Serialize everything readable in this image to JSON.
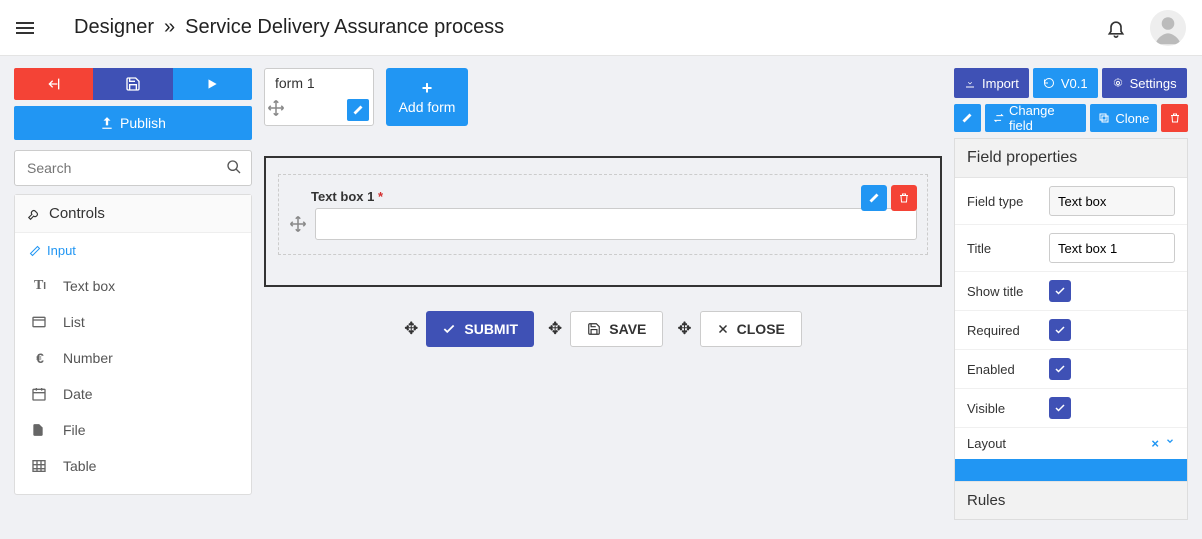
{
  "header": {
    "crumb1": "Designer",
    "sep": "»",
    "crumb2": "Service Delivery Assurance process"
  },
  "left": {
    "publish": "Publish",
    "search_placeholder": "Search",
    "controls_title": "Controls",
    "input_section": "Input",
    "items": [
      {
        "icon": "text-icon",
        "label": "Text box"
      },
      {
        "icon": "list-icon",
        "label": "List"
      },
      {
        "icon": "euro-icon",
        "label": "Number"
      },
      {
        "icon": "calendar-icon",
        "label": "Date"
      },
      {
        "icon": "file-icon",
        "label": "File"
      },
      {
        "icon": "table-icon",
        "label": "Table"
      }
    ]
  },
  "forms": {
    "chip_label": "form 1",
    "add_label": "Add form"
  },
  "field": {
    "label": "Text box 1",
    "asterisk": "*"
  },
  "buttons": {
    "submit": "SUBMIT",
    "save": "SAVE",
    "close": "CLOSE"
  },
  "right": {
    "import": "Import",
    "version": "V0.1",
    "settings": "Settings",
    "change_field": "Change field",
    "clone": "Clone",
    "props_title": "Field properties",
    "field_type_lbl": "Field type",
    "field_type_val": "Text box",
    "title_lbl": "Title",
    "title_val": "Text box 1",
    "show_title_lbl": "Show title",
    "required_lbl": "Required",
    "enabled_lbl": "Enabled",
    "visible_lbl": "Visible",
    "layout_lbl": "Layout",
    "rules_title": "Rules"
  }
}
